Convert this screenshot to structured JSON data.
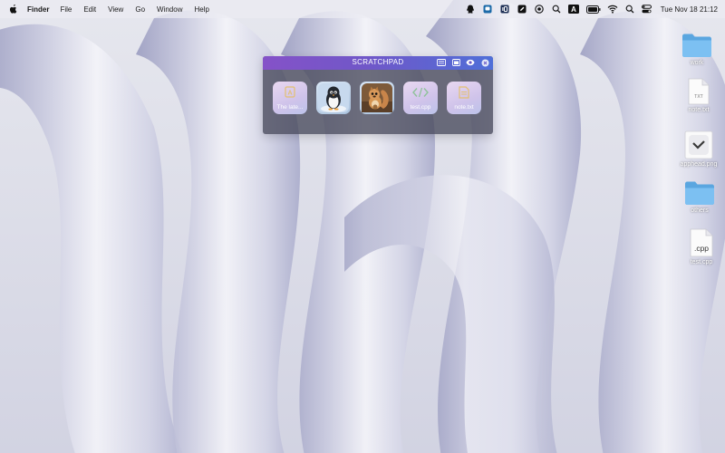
{
  "menubar": {
    "app_name": "Finder",
    "menus": [
      "File",
      "Edit",
      "View",
      "Go",
      "Window",
      "Help"
    ],
    "status_icons": [
      "qq-icon",
      "app-square-icon",
      "hd-icon",
      "edit-icon",
      "record-icon",
      "search-magnifier-icon",
      "keyboard-a-icon",
      "battery-icon",
      "wifi-icon",
      "spotlight-icon",
      "control-center-icon"
    ],
    "keyboard_letter": "A",
    "clock": "Tue Nov 18  21:12"
  },
  "scratchpad": {
    "title": "SCRATCHPAD",
    "accent_start": "#8552c8",
    "accent_end": "#4f6fd8",
    "items": [
      {
        "label": "The late...",
        "kind": "text-doc"
      },
      {
        "label": "",
        "kind": "image-penguin"
      },
      {
        "label": "",
        "kind": "image-squirrel"
      },
      {
        "label": "test.cpp",
        "kind": "code-file"
      },
      {
        "label": "note.txt",
        "kind": "text-file"
      }
    ]
  },
  "desktop": {
    "items": [
      {
        "label": "work",
        "kind": "folder"
      },
      {
        "label": "note.txt",
        "kind": "txt-file",
        "badge": "TXT"
      },
      {
        "label": "apphead.png",
        "kind": "png-file"
      },
      {
        "label": "others",
        "kind": "folder"
      },
      {
        "label": "test.cpp",
        "kind": "cpp-file",
        "badge": ".cpp"
      }
    ]
  }
}
